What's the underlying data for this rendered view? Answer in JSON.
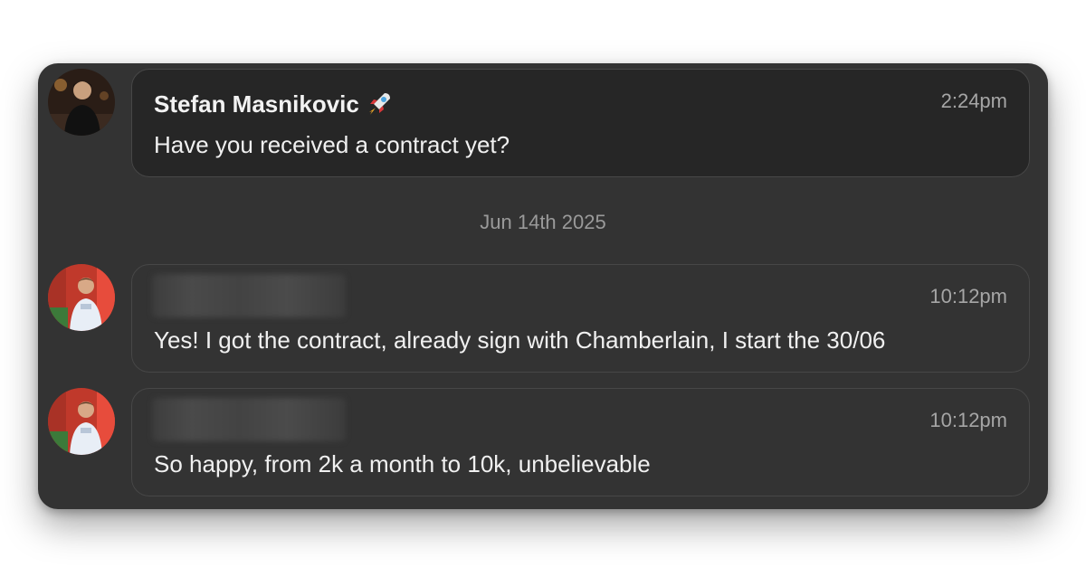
{
  "messages": [
    {
      "sender": "Stefan Masnikovic",
      "sender_emoji": "rocket-icon",
      "time": "2:24pm",
      "text": "Have you received a contract yet?"
    },
    {
      "sender": "",
      "time": "10:12pm",
      "text": "Yes! I got the contract, already sign with Chamberlain, I start the 30/06"
    },
    {
      "sender": "",
      "time": "10:12pm",
      "text": "So happy, from 2k a month to 10k, unbelievable"
    }
  ],
  "date_separator": "Jun 14th 2025",
  "colors": {
    "card_background": "#333333",
    "first_bubble_background": "#262626",
    "bubble_border": "#474747",
    "timestamp": "#a6a6a6"
  }
}
